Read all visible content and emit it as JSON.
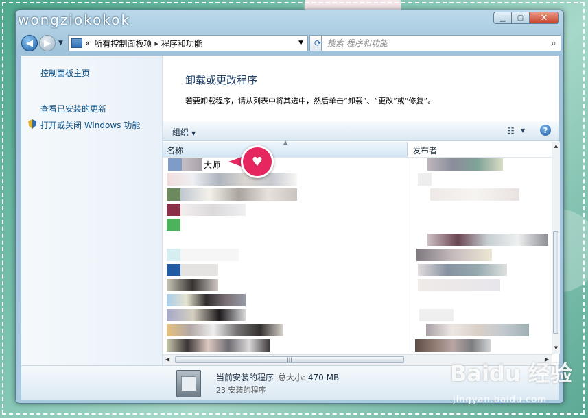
{
  "window": {
    "brand": "wongziokokok",
    "close": "✕"
  },
  "address": {
    "back": "◀",
    "forward": "▶",
    "crumb_sep": "«",
    "crumbs": [
      "所有控制面板项",
      "程序和功能"
    ],
    "search_placeholder": "搜索 程序和功能"
  },
  "leftpane": {
    "links": [
      "控制面板主页",
      "查看已安装的更新",
      "打开或关闭 Windows 功能"
    ]
  },
  "main": {
    "title": "卸载或更改程序",
    "subtitle": "若要卸载程序，请从列表中将其选中，然后单击“卸载”、“更改”或“修复”。",
    "toolbar": {
      "organize": "组织",
      "help": "?"
    },
    "columns": {
      "name": "名称",
      "publisher": "发布者"
    },
    "first_row_suffix": "大师"
  },
  "details": {
    "title": "当前安装的程序",
    "size_label": "总大小:",
    "size_value": "470 MB",
    "count": "23 安装的程序"
  },
  "watermark": {
    "brand": "Baidu 经验",
    "url": "jingyan.baidu.com"
  },
  "colors": {
    "accent": "#1e3f66",
    "link": "#0b4f84",
    "callout": "#e6265e"
  },
  "icons": [
    "search-icon",
    "refresh-icon",
    "control-panel-icon",
    "shield-icon",
    "help-icon",
    "view-icon",
    "heart-icon",
    "package-icon"
  ]
}
